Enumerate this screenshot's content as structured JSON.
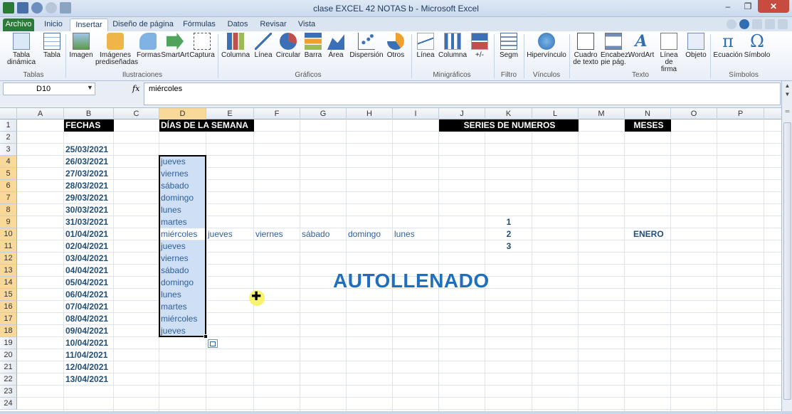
{
  "window": {
    "title": "clase EXCEL 42 NOTAS b  -  Microsoft Excel"
  },
  "tabs": [
    "Archivo",
    "Inicio",
    "Insertar",
    "Diseño de página",
    "Fórmulas",
    "Datos",
    "Revisar",
    "Vista"
  ],
  "active_tab": "Insertar",
  "ribbon": {
    "groups": [
      {
        "label": "Tablas",
        "buttons": [
          "Tabla dinámica",
          "Tabla"
        ]
      },
      {
        "label": "Ilustraciones",
        "buttons": [
          "Imagen",
          "Imágenes prediseñadas",
          "Formas",
          "SmartArt",
          "Captura"
        ]
      },
      {
        "label": "Gráficos",
        "buttons": [
          "Columna",
          "Línea",
          "Circular",
          "Barra",
          "Área",
          "Dispersión",
          "Otros"
        ]
      },
      {
        "label": "Minigráficos",
        "buttons": [
          "Línea",
          "Columna",
          "+/-"
        ]
      },
      {
        "label": "Filtro",
        "buttons": [
          "Segm"
        ]
      },
      {
        "label": "Vínculos",
        "buttons": [
          "Hipervínculo"
        ]
      },
      {
        "label": "Texto",
        "buttons": [
          "Cuadro de texto",
          "Encabez. pie pág.",
          "WordArt",
          "Línea de firma",
          "Objeto"
        ]
      },
      {
        "label": "Símbolos",
        "buttons": [
          "Ecuación",
          "Símbolo"
        ]
      }
    ],
    "icon_glyphs": {
      "Ecuación": "π",
      "Símbolo": "Ω",
      "WordArt": "A"
    }
  },
  "formula_bar": {
    "name_box": "D10",
    "fx": "fx",
    "value": "miércoles"
  },
  "columns": [
    "A",
    "B",
    "C",
    "D",
    "E",
    "F",
    "G",
    "H",
    "I",
    "J",
    "K",
    "L",
    "M",
    "N",
    "O",
    "P"
  ],
  "rows": [
    "1",
    "2",
    "3",
    "4",
    "5",
    "6",
    "7",
    "8",
    "9",
    "10",
    "11",
    "12",
    "13",
    "14",
    "15",
    "16",
    "17",
    "18",
    "19",
    "20",
    "21",
    "22",
    "23",
    "24"
  ],
  "selected_column": "D",
  "selected_rows": [
    "4",
    "5",
    "6",
    "7",
    "8",
    "9",
    "10",
    "11",
    "12",
    "13",
    "14",
    "15",
    "16",
    "17",
    "18"
  ],
  "headers": {
    "fechas": "FECHAS",
    "dias": "DÍAS DE LA SEMANA",
    "series": "SERIES DE NUMEROS",
    "meses": "MESES"
  },
  "dates": [
    "25/03/2021",
    "26/03/2021",
    "27/03/2021",
    "28/03/2021",
    "29/03/2021",
    "30/03/2021",
    "31/03/2021",
    "01/04/2021",
    "02/04/2021",
    "03/04/2021",
    "04/04/2021",
    "05/04/2021",
    "06/04/2021",
    "07/04/2021",
    "08/04/2021",
    "09/04/2021",
    "10/04/2021",
    "11/04/2021",
    "12/04/2021",
    "13/04/2021"
  ],
  "days_column": [
    "jueves",
    "viernes",
    "sábado",
    "domingo",
    "lunes",
    "martes",
    "miércoles",
    "jueves",
    "viernes",
    "sábado",
    "domingo",
    "lunes",
    "martes",
    "miércoles",
    "jueves"
  ],
  "row10_days": [
    "jueves",
    "viernes",
    "sábado",
    "domingo",
    "lunes"
  ],
  "numbers": [
    "1",
    "2",
    "3"
  ],
  "month": "ENERO",
  "overlay_text": "AUTOLLENADO",
  "colors": {
    "accent_blue": "#1f6fbf",
    "selection_fill": "#cfe0f5",
    "file_tab": "#2c7a37"
  }
}
